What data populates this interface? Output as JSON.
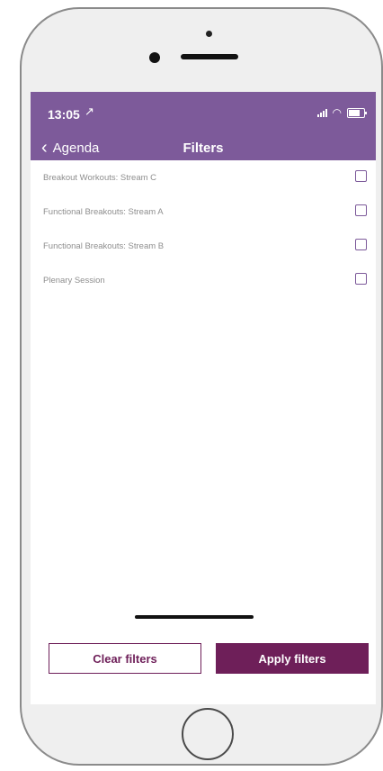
{
  "status_bar": {
    "time": "13:05",
    "location_icon": "↗"
  },
  "nav": {
    "back_label": "Agenda",
    "title": "Filters"
  },
  "filters": [
    {
      "label": "Breakout Workouts: Stream C",
      "checked": false
    },
    {
      "label": "Functional Breakouts: Stream A",
      "checked": false
    },
    {
      "label": "Functional Breakouts: Stream B",
      "checked": false
    },
    {
      "label": "Plenary Session",
      "checked": false
    }
  ],
  "footer": {
    "clear_label": "Clear filters",
    "apply_label": "Apply filters"
  },
  "colors": {
    "nav_bg": "#7d5a9a",
    "accent": "#6e1f59"
  }
}
